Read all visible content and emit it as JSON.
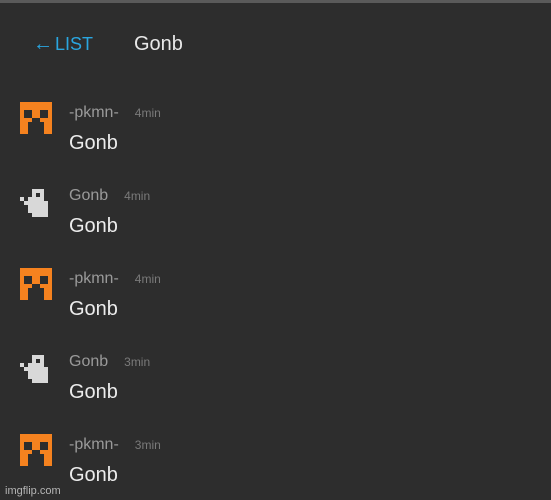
{
  "header": {
    "back_arrow": "←",
    "back_label": "LIST",
    "title": "Gonb"
  },
  "messages": [
    {
      "author": "-pkmn-",
      "time": "4min",
      "text": "Gonb",
      "avatar": "creeper-face-icon"
    },
    {
      "author": "Gonb",
      "time": "4min",
      "text": "Gonb",
      "avatar": "ghost-icon"
    },
    {
      "author": "-pkmn-",
      "time": "4min",
      "text": "Gonb",
      "avatar": "creeper-face-icon"
    },
    {
      "author": "Gonb",
      "time": "3min",
      "text": "Gonb",
      "avatar": "ghost-icon"
    },
    {
      "author": "-pkmn-",
      "time": "3min",
      "text": "Gonb",
      "avatar": "creeper-face-icon"
    }
  ],
  "watermark": "imgflip.com",
  "colors": {
    "background": "#2d2d2d",
    "accent": "#2aa6e0",
    "avatar_orange": "#f5821f",
    "avatar_gray": "#d8d8d8"
  }
}
